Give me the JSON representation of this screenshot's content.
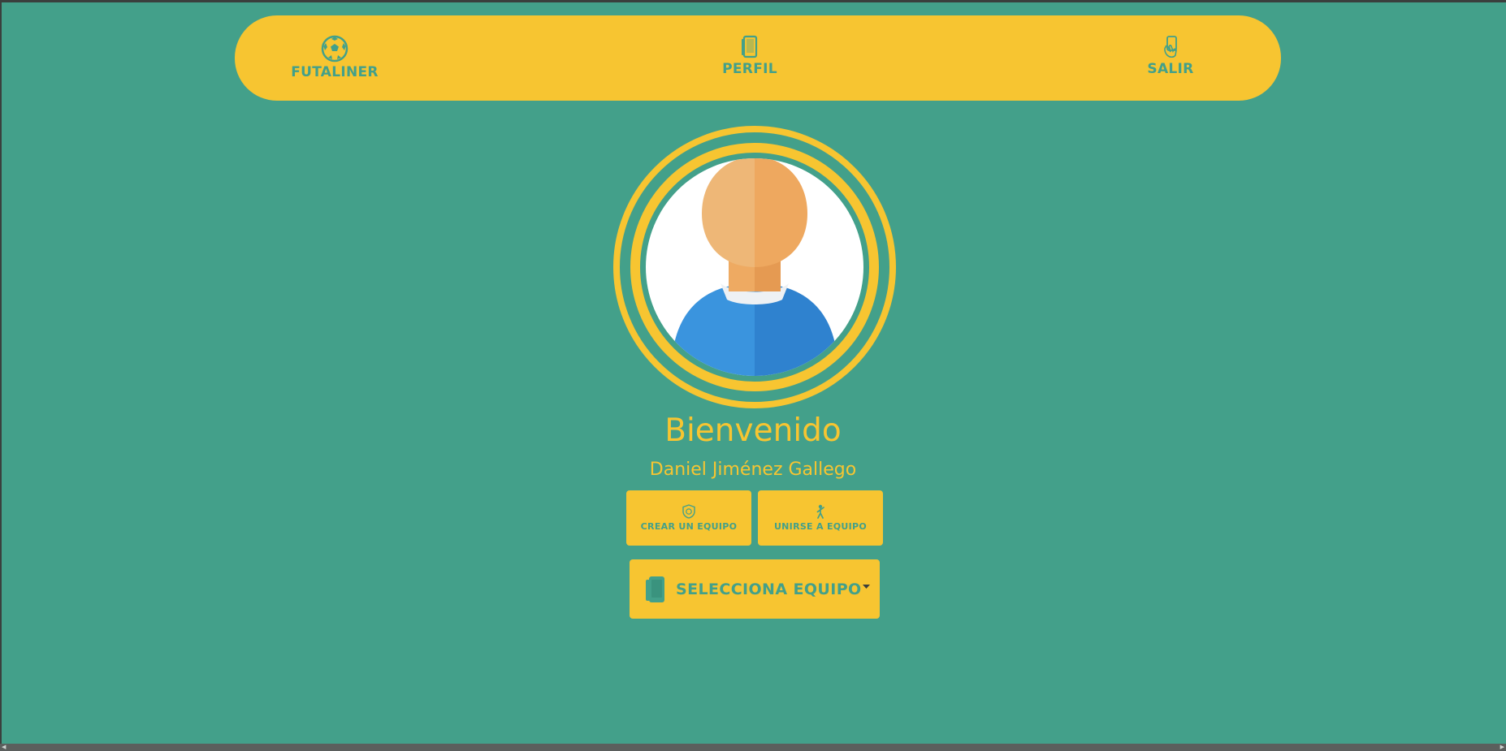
{
  "nav": {
    "brand_label": "FUTALINER",
    "brand_icon": "soccer-ball-icon",
    "profile_label": "PERFIL",
    "profile_icon": "phone-icon",
    "logout_label": "SALIR",
    "logout_icon": "hand-phone-icon"
  },
  "profile": {
    "avatar_icon": "user-avatar-icon",
    "welcome": "Bienvenido",
    "name": "Daniel Jiménez Gallego"
  },
  "actions": {
    "create_team_label": "CREAR UN EQUIPO",
    "create_team_icon": "badge-icon",
    "join_team_label": "UNIRSE A EQUIPO",
    "join_team_icon": "person-icon"
  },
  "team_select": {
    "label": "SELECCIONA EQUIPO",
    "icon": "phone-icon"
  },
  "colors": {
    "background": "#43a08a",
    "accent": "#f7c531",
    "text_on_accent": "#43a08a"
  }
}
